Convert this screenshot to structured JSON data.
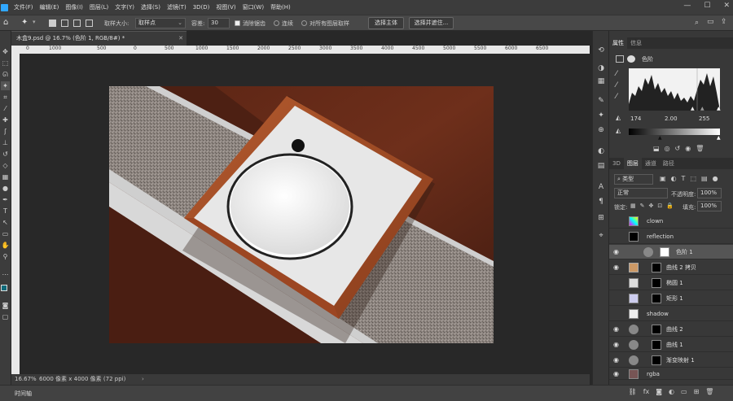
{
  "menu": [
    "文件(F)",
    "编辑(E)",
    "图像(I)",
    "图层(L)",
    "文字(Y)",
    "选择(S)",
    "滤镜(T)",
    "3D(D)",
    "视图(V)",
    "窗口(W)",
    "帮助(H)"
  ],
  "options": {
    "sample_size_label": "取样大小:",
    "sample_size_value": "取样点",
    "tolerance_label": "容差:",
    "tolerance_value": "30",
    "antialias_label": "消除锯齿",
    "contiguous_label": "连续",
    "all_layers_label": "对所有图层取样",
    "select_subject_label": "选择主体",
    "select_and_mask_label": "选择并遮住..."
  },
  "document": {
    "tab_title": "木盒9.psd @ 16.7% (色阶 1, RGB/8#) *",
    "ruler_ticks": [
      "0",
      "1000",
      "500",
      "0",
      "500",
      "1000",
      "1500",
      "2000",
      "2500",
      "3000",
      "3500",
      "4000",
      "4500",
      "5000",
      "5500",
      "6000",
      "6500"
    ],
    "zoom": "16.67%",
    "doc_info": "6000 像素 x 4000 像素 (72 ppi)",
    "timeline_tab": "时间轴"
  },
  "properties": {
    "tabs": [
      "属性",
      "信息"
    ],
    "title": "色阶",
    "input_black": "174",
    "input_gamma": "2.00",
    "input_white": "255"
  },
  "layers_panel": {
    "tabs": [
      "3D",
      "图层",
      "通道",
      "路径"
    ],
    "filter_label": "类型",
    "blend_mode": "正常",
    "opacity_label": "不透明度:",
    "opacity_value": "100%",
    "lock_label": "锁定:",
    "fill_label": "填充:",
    "fill_value": "100%",
    "layers": [
      {
        "name": "clown",
        "visible": false
      },
      {
        "name": "reflection",
        "visible": false
      },
      {
        "name": "色阶 1",
        "visible": true,
        "selected": true
      },
      {
        "name": "曲线 2 拷贝",
        "visible": true
      },
      {
        "name": "椭圆 1",
        "visible": false
      },
      {
        "name": "矩形 1",
        "visible": false
      },
      {
        "name": "shadow",
        "visible": false
      },
      {
        "name": "曲线 2",
        "visible": true
      },
      {
        "name": "曲线 1",
        "visible": true
      },
      {
        "name": "渐变映射 1",
        "visible": true
      },
      {
        "name": "rgba",
        "visible": true
      }
    ]
  },
  "colors": {
    "accent": "#31a8ff",
    "panel": "#383838",
    "canvas_bg": "#282828"
  }
}
